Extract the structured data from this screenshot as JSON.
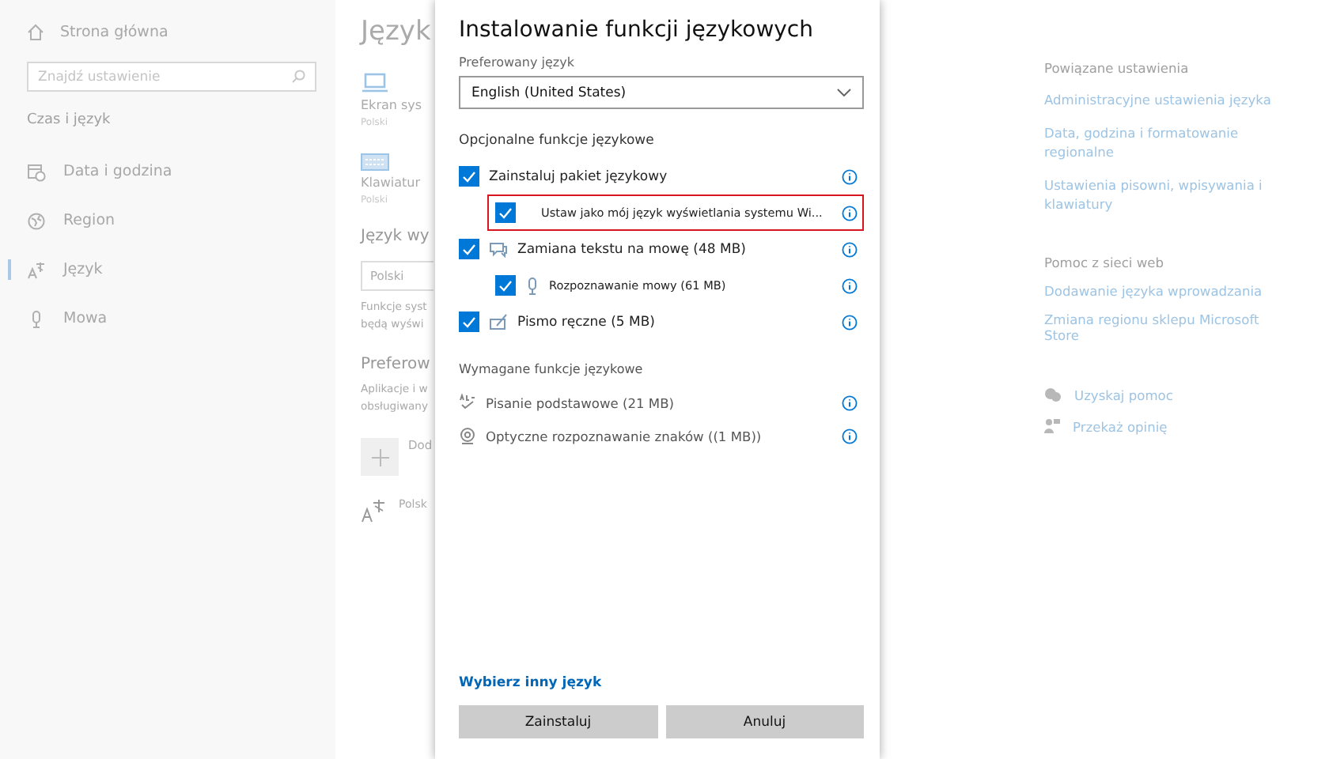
{
  "nav": {
    "home": "Strona główna",
    "search": {
      "placeholder": "Znajdź ustawienie"
    },
    "section": "Czas i język",
    "items": [
      {
        "label": "Data i godzina",
        "selected": false
      },
      {
        "label": "Region",
        "selected": false
      },
      {
        "label": "Język",
        "selected": true
      },
      {
        "label": "Mowa",
        "selected": false
      }
    ]
  },
  "main": {
    "title": "Język",
    "tiles": [
      {
        "label": "Ekran sys",
        "sub": "Polski"
      },
      {
        "label": "Klawiatur",
        "sub": "Polski"
      }
    ],
    "display_heading": "Język wy",
    "display_select": "Polski",
    "display_desc": [
      "Funkcje syst",
      "będą wyświ"
    ],
    "preferred_heading": "Preferow",
    "preferred_desc": [
      "Aplikacje i w",
      "obsługiwany"
    ],
    "add_label": "Dod",
    "language_item": "Polsk"
  },
  "dialog": {
    "title": "Instalowanie funkcji językowych",
    "field_label": "Preferowany język",
    "select_value": "English (United States)",
    "optional_heading": "Opcjonalne funkcje językowe",
    "options": [
      {
        "label": "Zainstaluj pakiet językowy",
        "checked": true,
        "highlighted": false,
        "children": [
          {
            "label": "Ustaw jako mój język wyświetlania systemu Wi...",
            "checked": true,
            "highlighted": true
          }
        ]
      },
      {
        "label": "Zamiana tekstu na mowę (48 MB)",
        "checked": true,
        "highlighted": false,
        "children": [
          {
            "label": "Rozpoznawanie mowy (61 MB)",
            "checked": true,
            "highlighted": false
          }
        ]
      },
      {
        "label": "Pismo ręczne (5 MB)",
        "checked": true,
        "highlighted": false
      }
    ],
    "required_heading": "Wymagane funkcje językowe",
    "required": [
      "Pisanie podstawowe (21 MB)",
      "Optyczne rozpoznawanie znaków ((1 MB))"
    ],
    "link": "Wybierz inny język",
    "buttons": [
      "Zainstaluj",
      "Anuluj"
    ]
  },
  "related": {
    "heading": "Powiązane ustawienia",
    "links": [
      "Administracyjne ustawienia języka",
      "Data, godzina i formatowanie regionalne",
      "Ustawienia pisowni, wpisywania i klawiatury"
    ],
    "web_heading": "Pomoc z sieci web",
    "web_links": [
      "Dodawanie języka wprowadzania",
      "Zmiana regionu sklepu Microsoft Store"
    ],
    "help": [
      "Uzyskaj pomoc",
      "Przekaż opinię"
    ]
  }
}
